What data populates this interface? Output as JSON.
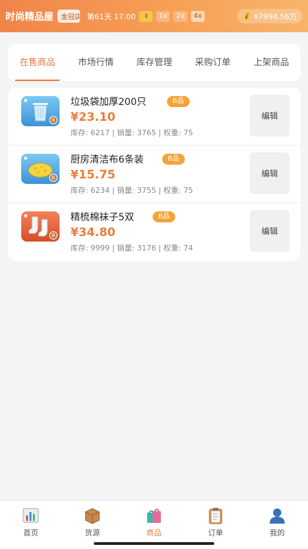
{
  "header": {
    "shop_name": "时尚精品屋",
    "rank": "金冠店铺",
    "day_time": "第61天 17:00",
    "speeds": {
      "pause": "II",
      "s1": "1x",
      "s2": "2x",
      "s4": "4x"
    },
    "money": "¥7994.56万",
    "money_icon": "money-bag-icon"
  },
  "tabs": [
    {
      "label": "在售商品",
      "active": true
    },
    {
      "label": "市场行情",
      "active": false
    },
    {
      "label": "库存管理",
      "active": false
    },
    {
      "label": "采购订单",
      "active": false
    },
    {
      "label": "上架商品",
      "active": false
    }
  ],
  "products": [
    {
      "name": "垃圾袋加厚200只",
      "grade": "B品",
      "price": "¥23.10",
      "stats": "库存: 6217 | 销量: 3765 | 权重: 75",
      "edit": "编辑",
      "thumb_color": "blue",
      "icon": "trash-can-icon",
      "grade_mark": "B"
    },
    {
      "name": "厨房清洁布6条装",
      "grade": "B品",
      "price": "¥15.75",
      "stats": "库存: 6234 | 销量: 3755 | 权重: 75",
      "edit": "编辑",
      "thumb_color": "blue",
      "icon": "sponge-icon",
      "grade_mark": "B"
    },
    {
      "name": "精梳棉袜子5双",
      "grade": "B品",
      "price": "¥34.80",
      "stats": "库存: 9999 | 销量: 3176 | 权重: 74",
      "edit": "编辑",
      "thumb_color": "orange",
      "icon": "socks-icon",
      "grade_mark": "B"
    }
  ],
  "nav": [
    {
      "label": "首页",
      "icon": "bar-chart-icon",
      "active": false
    },
    {
      "label": "货源",
      "icon": "package-icon",
      "active": false
    },
    {
      "label": "商品",
      "icon": "shopping-bags-icon",
      "active": true
    },
    {
      "label": "订单",
      "icon": "clipboard-icon",
      "active": false
    },
    {
      "label": "我的",
      "icon": "user-icon",
      "active": false
    }
  ],
  "colors": {
    "accent": "#e87a3c",
    "price": "#e97e3f",
    "badge": "#f3a33a"
  }
}
